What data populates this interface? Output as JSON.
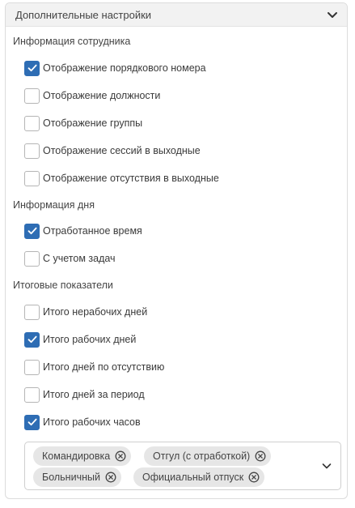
{
  "panel": {
    "title": "Дополнительные настройки"
  },
  "sections": [
    {
      "title": "Информация сотрудника"
    },
    {
      "title": "Информация дня"
    },
    {
      "title": "Итоговые показатели"
    }
  ],
  "options": [
    {
      "label": "Отображение порядкового номера",
      "checked": true
    },
    {
      "label": "Отображение должности",
      "checked": false
    },
    {
      "label": "Отображение группы",
      "checked": false
    },
    {
      "label": "Отображение сессий в выходные",
      "checked": false
    },
    {
      "label": "Отображение отсутствия в выходные",
      "checked": false
    },
    {
      "label": "Отработанное время",
      "checked": true
    },
    {
      "label": "С учетом задач",
      "checked": false
    },
    {
      "label": "Итого нерабочих дней",
      "checked": false
    },
    {
      "label": "Итого рабочих дней",
      "checked": true
    },
    {
      "label": "Итого дней по отсутствию",
      "checked": false
    },
    {
      "label": "Итого дней за период",
      "checked": false
    },
    {
      "label": "Итого рабочих часов",
      "checked": true
    }
  ],
  "absence_types": {
    "selected": [
      {
        "label": "Командировка"
      },
      {
        "label": "Отгул (с отработкой)"
      },
      {
        "label": "Больничный"
      },
      {
        "label": "Официальный отпуск"
      }
    ]
  },
  "colors": {
    "accent": "#2e6db4",
    "header_bg": "#f2f2f2",
    "chip_bg": "#e6e6e6"
  },
  "icons": {
    "collapse": "chevron-up-icon",
    "dropdown": "chevron-down-icon",
    "chip_remove": "circle-x-icon",
    "check": "check-icon"
  }
}
